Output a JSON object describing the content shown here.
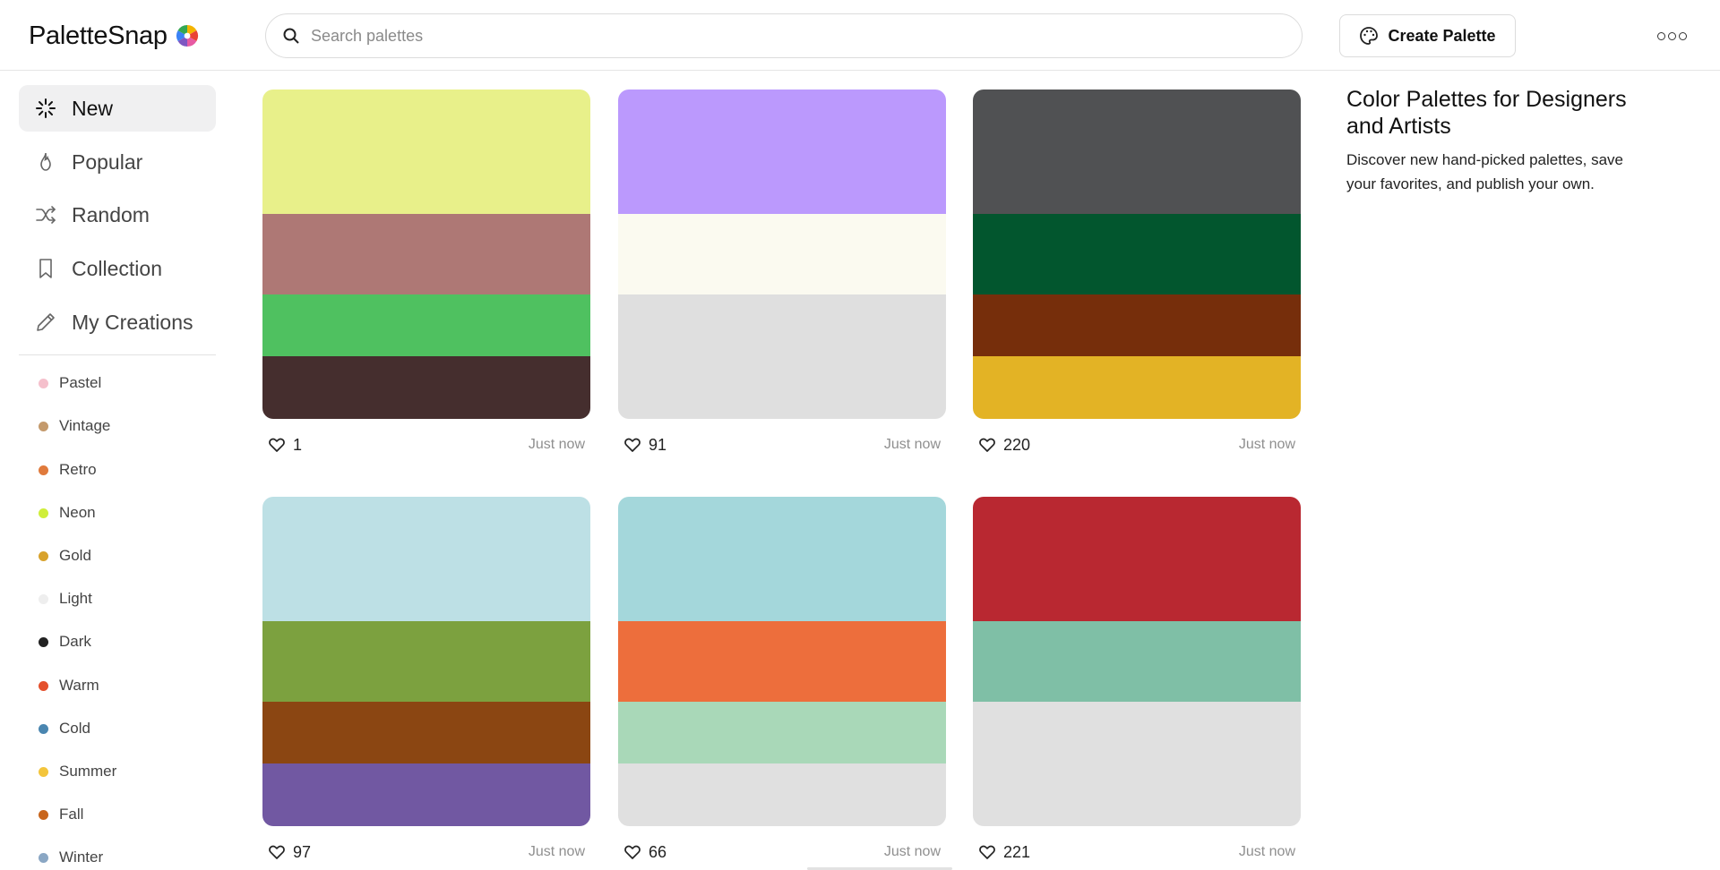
{
  "app": {
    "name": "PaletteSnap"
  },
  "search": {
    "placeholder": "Search palettes"
  },
  "header": {
    "create_label": "Create Palette"
  },
  "nav": [
    {
      "label": "New",
      "icon": "sparkle-icon",
      "active": true
    },
    {
      "label": "Popular",
      "icon": "flame-icon"
    },
    {
      "label": "Random",
      "icon": "shuffle-icon"
    },
    {
      "label": "Collection",
      "icon": "bookmark-icon"
    },
    {
      "label": "My Creations",
      "icon": "pencil-icon"
    }
  ],
  "tags": [
    {
      "label": "Pastel",
      "color": "#f5c0cc"
    },
    {
      "label": "Vintage",
      "color": "#c49a6c"
    },
    {
      "label": "Retro",
      "color": "#e07a3c"
    },
    {
      "label": "Neon",
      "color": "#cfee3a"
    },
    {
      "label": "Gold",
      "color": "#d8a22c"
    },
    {
      "label": "Light",
      "color": "#eeeeee"
    },
    {
      "label": "Dark",
      "color": "#222222"
    },
    {
      "label": "Warm",
      "color": "#e4502c"
    },
    {
      "label": "Cold",
      "color": "#4a86b0"
    },
    {
      "label": "Summer",
      "color": "#f3c53c"
    },
    {
      "label": "Fall",
      "color": "#c8651c"
    },
    {
      "label": "Winter",
      "color": "#8aa7c4"
    }
  ],
  "palettes": [
    {
      "colors": [
        "#e8f08a",
        "#ae7875",
        "#4fc160",
        "#452e2e"
      ],
      "likes": "1",
      "time": "Just now"
    },
    {
      "colors": [
        "#bb99fd",
        "#fbfaf0",
        "#dfdfdf"
      ],
      "likes": "91",
      "time": "Just now"
    },
    {
      "colors": [
        "#505153",
        "#02562e",
        "#762e0b",
        "#e3b325"
      ],
      "likes": "220",
      "time": "Just now"
    },
    {
      "colors": [
        "#bde0e5",
        "#7ca13f",
        "#8b4612",
        "#7158a2"
      ],
      "likes": "97",
      "time": "Just now"
    },
    {
      "colors": [
        "#a4d7db",
        "#ed6e3c",
        "#a9d8b8",
        "#e0e0e0"
      ],
      "likes": "66",
      "time": "Just now"
    },
    {
      "colors": [
        "#b92831",
        "#7fbfa6",
        "#e0e0e0"
      ],
      "likes": "221",
      "time": "Just now"
    }
  ],
  "intro": {
    "title": "Color Palettes for Designers and Artists",
    "text": "Discover new hand-picked palettes, save your favorites, and publish your own."
  }
}
